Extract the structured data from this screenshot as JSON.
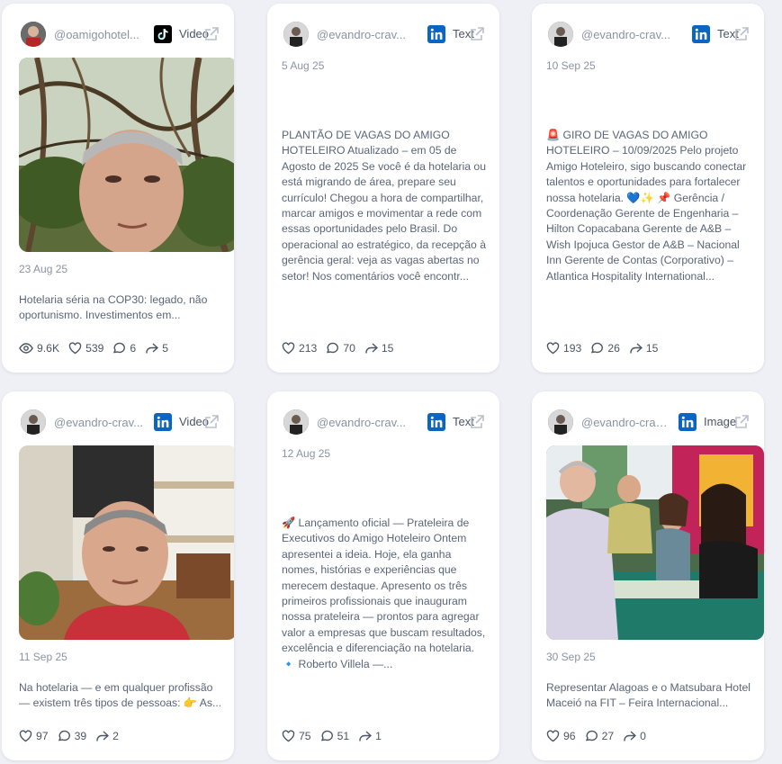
{
  "cards": [
    {
      "handle": "@oamigohotel...",
      "platform": "tiktok",
      "type": "Video",
      "date": "23 Aug 25",
      "caption": "Hotelaria séria na COP30: legado, não oportunismo. Investimentos em...",
      "views": "9.6K",
      "likes": "539",
      "comments": "6",
      "shares": "5",
      "media": "video-selfie-trees"
    },
    {
      "handle": "@evandro-crav...",
      "platform": "linkedin",
      "type": "Text",
      "date": "5 Aug 25",
      "caption": "PLANTÃO DE VAGAS DO AMIGO HOTELEIRO Atualizado – em 05 de Agosto de 2025 Se você é da hotelaria ou está migrando de área, prepare seu currículo! Chegou a hora de compartilhar, marcar amigos e movimentar a rede com essas oportunidades pelo Brasil. Do operacional ao estratégico, da recepção à gerência geral: veja as vagas abertas no setor! Nos comentários você encontr...",
      "likes": "213",
      "comments": "70",
      "shares": "15"
    },
    {
      "handle": "@evandro-crav...",
      "platform": "linkedin",
      "type": "Text",
      "date": "10 Sep 25",
      "caption": "🚨 GIRO DE VAGAS DO AMIGO HOTELEIRO – 10/09/2025 Pelo projeto Amigo Hoteleiro, sigo buscando conectar talentos e oportunidades para fortalecer nossa hotelaria. 💙✨ 📌 Gerência / Coordenação Gerente de Engenharia – Hilton Copacabana Gerente de A&B – Wish Ipojuca Gestor de A&B – Nacional Inn Gerente de Contas (Corporativo) – Atlantica Hospitality International...",
      "likes": "193",
      "comments": "26",
      "shares": "15"
    },
    {
      "handle": "@evandro-crav...",
      "platform": "linkedin",
      "type": "Video",
      "date": "11 Sep 25",
      "caption": "Na hotelaria — e em qualquer profissão — existem três tipos de pessoas: 👉 As...",
      "likes": "97",
      "comments": "39",
      "shares": "2",
      "media": "video-selfie-hotel-atrium"
    },
    {
      "handle": "@evandro-crav...",
      "platform": "linkedin",
      "type": "Text",
      "date": "12 Aug 25",
      "caption": "🚀 Lançamento oficial — Prateleira de Executivos do Amigo Hoteleiro Ontem apresentei a ideia. Hoje, ela ganha nomes, histórias e experiências que merecem destaque. Apresento os três primeiros profissionais que inauguram nossa prateleira — prontos para agregar valor a empresas que buscam resultados, excelência e diferenciação na hotelaria. 🔹 Roberto Villela —...",
      "likes": "75",
      "comments": "51",
      "shares": "1"
    },
    {
      "handle": "@evandro-crav...",
      "platform": "linkedin",
      "type": "Image",
      "date": "30 Sep 25",
      "caption": "Representar Alagoas e o Matsubara Hotel Maceió na FIT – Feira Internacional...",
      "likes": "96",
      "comments": "27",
      "shares": "0",
      "media": "photo-trade-fair-booth"
    }
  ],
  "colors": {
    "background": "#eef0f5",
    "card": "#ffffff",
    "linkedin": "#0a66c2",
    "tiktok": "#000000",
    "muted": "#8a93a3"
  },
  "icons": [
    "eye-icon",
    "heart-icon",
    "comment-icon",
    "share-icon",
    "external-link-icon",
    "linkedin-icon",
    "tiktok-icon"
  ]
}
